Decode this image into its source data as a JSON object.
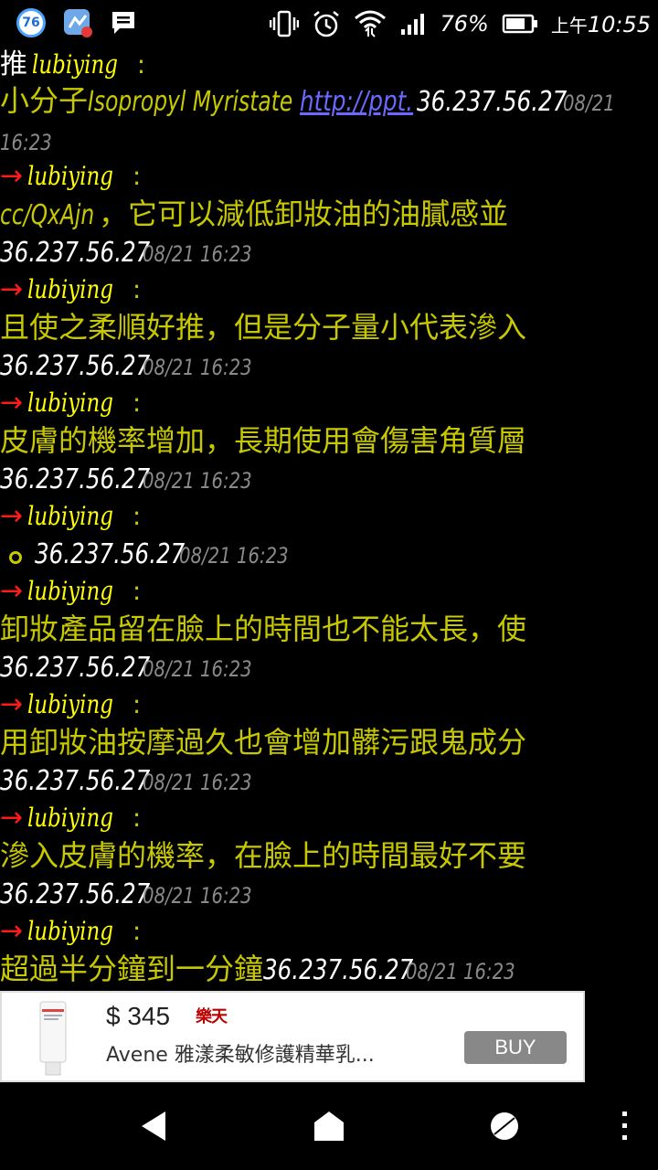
{
  "status_bar": {
    "badge": "76",
    "battery": "76%",
    "time_prefix": "上午",
    "time": "10:55",
    "icons": [
      "notification-badge-icon",
      "messenger-icon",
      "message-icon",
      "vibrate-icon",
      "alarm-icon",
      "wifi-icon",
      "signal-icon",
      "battery-icon"
    ]
  },
  "comments": {
    "push_tag": "推",
    "arrow": "→",
    "username": "lubiying",
    "colon": ":",
    "c1": {
      "text": "小分子",
      "latin": "Isopropyl Myristate",
      "link": "http://ppt.",
      "ip": "36.237.56.27",
      "date": "08/21",
      "time": "16:23"
    },
    "c2": {
      "text": "cc/QxAjn",
      "cjk": "，它可以減低卸妝油的油膩感並",
      "ip": "36.237.56.27",
      "ts": "08/21 16:23"
    },
    "c3": {
      "text": "且使之柔順好推，但是分子量小代表滲入",
      "ip": "36.237.56.27",
      "ts": "08/21 16:23"
    },
    "c4": {
      "text": "皮膚的機率增加，長期使用會傷害角質層",
      "ip": "36.237.56.27",
      "ts": "08/21 16:23"
    },
    "c5": {
      "ip": "36.237.56.27",
      "ts": "08/21 16:23"
    },
    "c6": {
      "text": "卸妝產品留在臉上的時間也不能太長，使",
      "ip": "36.237.56.27",
      "ts": "08/21 16:23"
    },
    "c7": {
      "text": "用卸妝油按摩過久也會增加髒污跟鬼成分",
      "ip": "36.237.56.27",
      "ts": "08/21 16:23"
    },
    "c8": {
      "text": "滲入皮膚的機率，在臉上的時間最好不要",
      "ip": "36.237.56.27",
      "ts": "08/21 16:23"
    },
    "c9": {
      "text": "超過半分鐘到一分鐘",
      "ip": "36.237.56.27",
      "ts": "08/21 16:23"
    }
  },
  "ad": {
    "price": "$ 345",
    "logo": "樂天",
    "title": "Avene 雅漾柔敏修護精華乳...",
    "buy_label": "BUY"
  },
  "nav": {
    "icons": [
      "back-icon",
      "home-icon",
      "recents-icon",
      "menu-icon"
    ]
  }
}
